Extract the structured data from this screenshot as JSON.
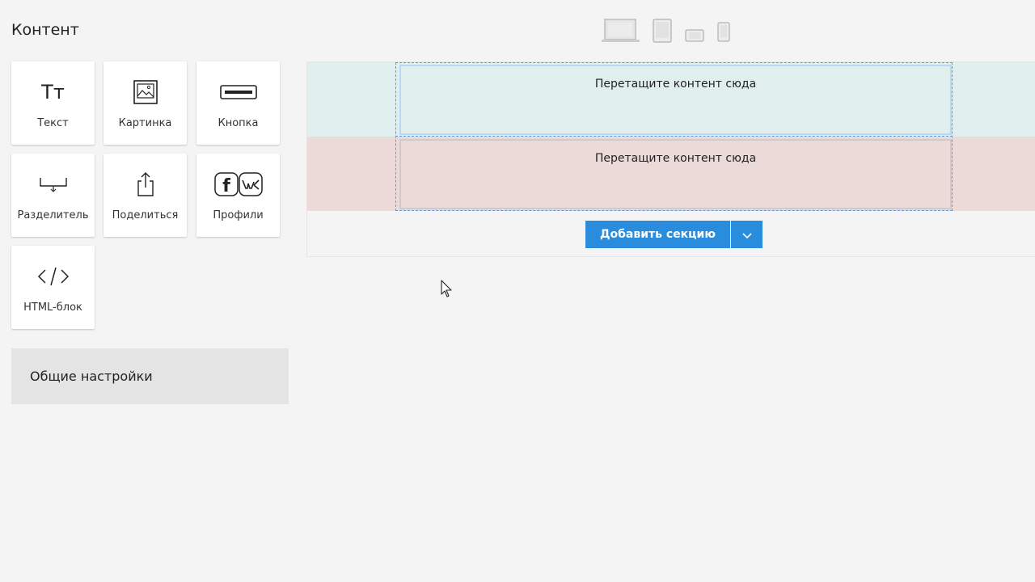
{
  "sidebar": {
    "title": "Контент",
    "tiles": [
      {
        "label": "Текст",
        "icon": "text-icon"
      },
      {
        "label": "Картинка",
        "icon": "image-icon"
      },
      {
        "label": "Кнопка",
        "icon": "button-icon"
      },
      {
        "label": "Разделитель",
        "icon": "divider-icon"
      },
      {
        "label": "Поделиться",
        "icon": "share-icon"
      },
      {
        "label": "Профили",
        "icon": "social-profiles-icon"
      },
      {
        "label": "HTML-блок",
        "icon": "code-icon"
      }
    ],
    "text_icon_glyph": "Тт",
    "social_icon_letter": "f",
    "settings_label": "Общие настройки"
  },
  "devices": [
    "desktop-icon",
    "tablet-icon",
    "landscape-phone-icon",
    "phone-icon"
  ],
  "canvas": {
    "dropzone_1": "Перетащите контент сюда",
    "dropzone_2": "Перетащите контент сюда",
    "add_section_label": "Добавить секцию"
  },
  "colors": {
    "accent": "#2a8cdc",
    "section_1_bg": "#e0eeee",
    "section_2_bg": "#ecdad9",
    "selection_border": "#5b9be4"
  }
}
